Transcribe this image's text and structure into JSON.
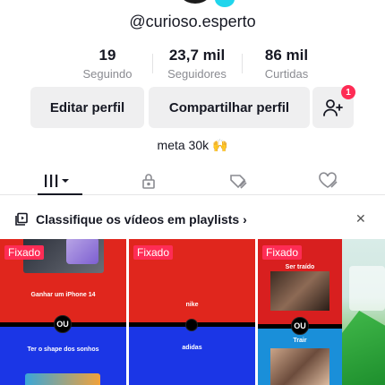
{
  "profile": {
    "username": "@curioso.esperto",
    "bio": "meta 30k 🙌"
  },
  "stats": [
    {
      "value": "19",
      "label": "Seguindo"
    },
    {
      "value": "23,7 mil",
      "label": "Seguidores"
    },
    {
      "value": "86 mil",
      "label": "Curtidas"
    }
  ],
  "actions": {
    "edit_label": "Editar perfil",
    "share_label": "Compartilhar perfil",
    "add_friend_badge": "1"
  },
  "tabs": [
    {
      "icon": "grid-icon",
      "active": true
    },
    {
      "icon": "lock-icon",
      "active": false
    },
    {
      "icon": "tag-hidden-icon",
      "active": false
    },
    {
      "icon": "heart-hidden-icon",
      "active": false
    }
  ],
  "banner": {
    "text": "Classifique os vídeos em playlists",
    "chevron": "›",
    "close": "✕"
  },
  "videos": [
    {
      "pinned": "Fixado",
      "top_caption": "Ganhar um iPhone 14",
      "ou": "OU",
      "bottom_caption": "Ter o shape dos sonhos"
    },
    {
      "pinned": "Fixado",
      "top_caption": "nike",
      "ou": "",
      "bottom_caption": "adidas"
    },
    {
      "pinned": "Fixado",
      "top_caption": "Ser traído",
      "ou": "OU",
      "bottom_caption": "Trair"
    },
    {
      "pinned": "",
      "top_caption": "",
      "ou": "",
      "bottom_caption": ""
    }
  ],
  "colors": {
    "accent_red": "#fe2c55",
    "button_bg": "#efeff0",
    "muted_text": "#8a8b91"
  }
}
